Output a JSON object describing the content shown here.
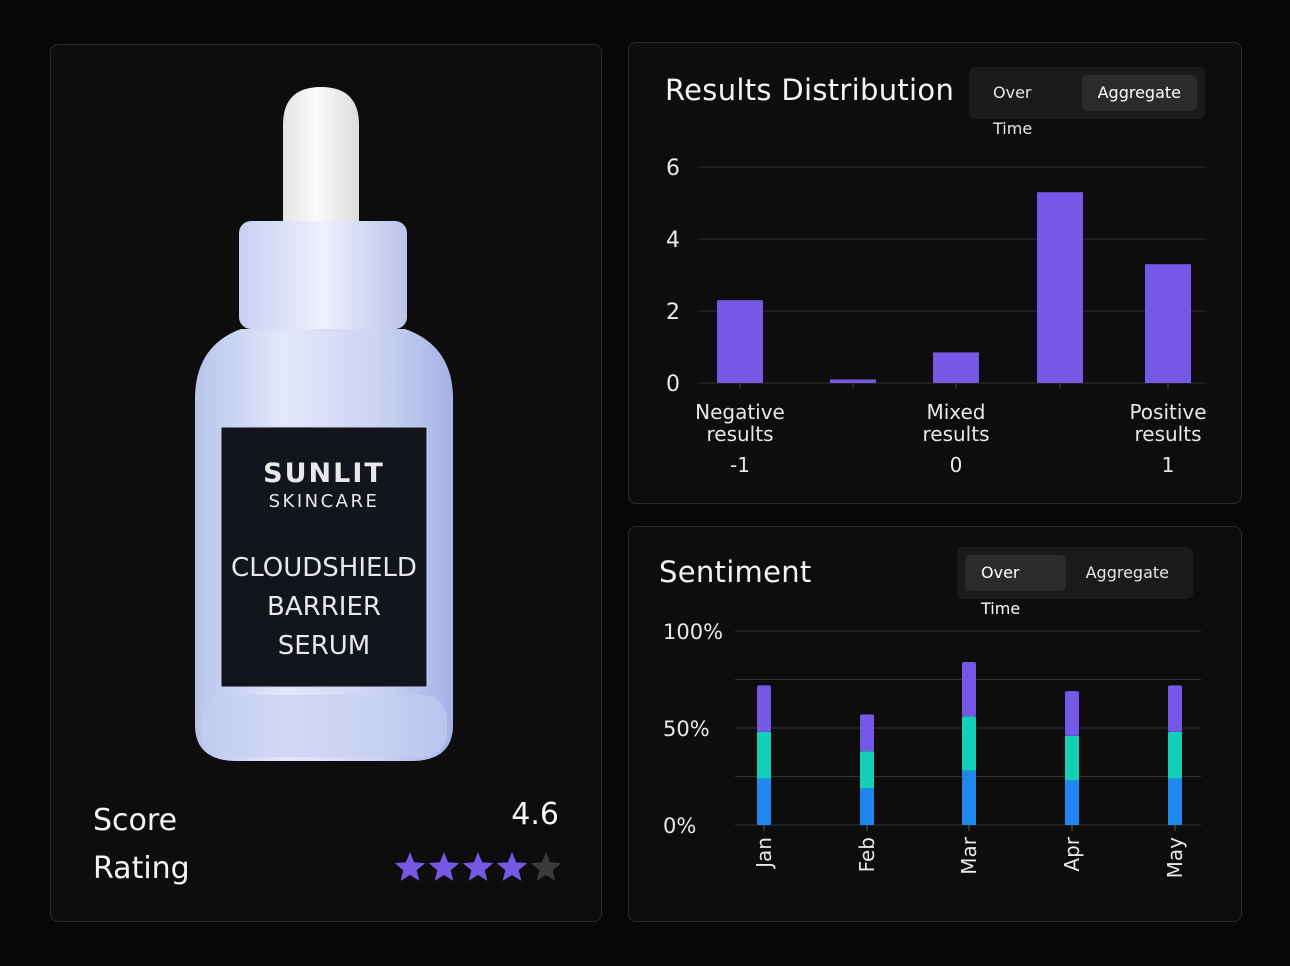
{
  "product": {
    "brand_line1": "SUNLIT",
    "brand_line2": "SKINCARE",
    "name_line1": "CLOUDSHIELD",
    "name_line2": "BARRIER",
    "name_line3": "SERUM",
    "score_label": "Score",
    "score_value": "4.6",
    "rating_label": "Rating",
    "rating_stars": 4,
    "rating_max": 5
  },
  "distribution": {
    "title": "Results Distribution",
    "toggle": {
      "left": "Over Time",
      "right": "Aggregate",
      "active": "Aggregate"
    }
  },
  "sentiment": {
    "title": "Sentiment",
    "toggle": {
      "left": "Over Time",
      "right": "Aggregate",
      "active": "Over Time"
    }
  },
  "colors": {
    "accent_purple": "#7658e6",
    "teal": "#13cfb7",
    "blue": "#1f86f0",
    "star_empty": "#3a3a3a"
  },
  "chart_data": [
    {
      "type": "bar",
      "categories": [
        "",
        "",
        "",
        "",
        ""
      ],
      "values": [
        2.3,
        0.1,
        0.85,
        5.3,
        3.3
      ],
      "ylim": [
        0,
        6
      ],
      "yticks": [
        "0",
        "2",
        "4",
        "6"
      ],
      "category_labels": [
        {
          "index": 0,
          "line1": "Negative",
          "line2": "results",
          "value_label": "-1"
        },
        {
          "index": 2,
          "line1": "Mixed",
          "line2": "results",
          "value_label": "0"
        },
        {
          "index": 4,
          "line1": "Positive",
          "line2": "results",
          "value_label": "1"
        }
      ],
      "grid": true
    },
    {
      "type": "bar",
      "stacked": true,
      "categories": [
        "Jan",
        "Feb",
        "Mar",
        "Apr",
        "May"
      ],
      "series": [
        {
          "color": "#1f86f0",
          "values": [
            24,
            19,
            28,
            23,
            24
          ]
        },
        {
          "color": "#13cfb7",
          "values": [
            24,
            19,
            28,
            23,
            24
          ]
        },
        {
          "color": "#7658e6",
          "values": [
            24,
            19,
            28,
            23,
            24
          ]
        }
      ],
      "ylim": [
        0,
        100
      ],
      "yticks": [
        "0%",
        "50%",
        "100%"
      ],
      "grid": true
    }
  ]
}
